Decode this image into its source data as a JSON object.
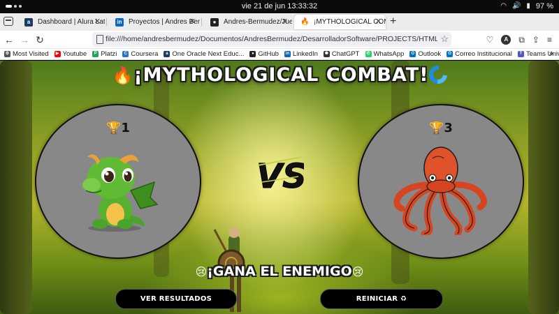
{
  "os": {
    "clock": "vie 21 de jun  13:33:32",
    "battery": "97 %"
  },
  "tabs": [
    {
      "label": "Dashboard | Alura Latam",
      "favicon": "alura-icon",
      "color": "#1a3c5e",
      "glyph": "a"
    },
    {
      "label": "Proyectos | Andres Bermu",
      "favicon": "linkedin-icon",
      "color": "#0a66c2",
      "glyph": "in"
    },
    {
      "label": "Andres-Bermudez/Juego",
      "favicon": "github-icon",
      "color": "#222222",
      "glyph": "●"
    },
    {
      "label": "¡MYTHOLOGICAL COMBA",
      "favicon": "fire-icon",
      "color": "#ff7a00",
      "glyph": "🔥"
    }
  ],
  "nav": {
    "url": "file:///home/andresbermudez/Documentos/AndresBermudez/DesarrolladorSoftware/PROJECTS/HTML - CSS - JAVASCRIPT/",
    "account_initial": "A"
  },
  "bookmarks": [
    {
      "label": "Most Visited",
      "icon": "gear-icon",
      "color": "#555555",
      "glyph": "⚙"
    },
    {
      "label": "Youtube",
      "icon": "youtube-icon",
      "color": "#ff0000",
      "glyph": "▶"
    },
    {
      "label": "Platzi",
      "icon": "platzi-icon",
      "color": "#22a35a",
      "glyph": "P"
    },
    {
      "label": "Coursera",
      "icon": "coursera-icon",
      "color": "#2a73cc",
      "glyph": "C"
    },
    {
      "label": "One Oracle Next Educ...",
      "icon": "alura-icon",
      "color": "#1a3c5e",
      "glyph": "a"
    },
    {
      "label": "GitHub",
      "icon": "github-icon",
      "color": "#222222",
      "glyph": "●"
    },
    {
      "label": "LinkedIn",
      "icon": "linkedin-icon",
      "color": "#0a66c2",
      "glyph": "in"
    },
    {
      "label": "ChatGPT",
      "icon": "chatgpt-icon",
      "color": "#333333",
      "glyph": "✺"
    },
    {
      "label": "WhatsApp",
      "icon": "whatsapp-icon",
      "color": "#25d366",
      "glyph": "✆"
    },
    {
      "label": "Outlook",
      "icon": "outlook-icon",
      "color": "#0072c6",
      "glyph": "O"
    },
    {
      "label": "Correo Institucional",
      "icon": "outlook-icon",
      "color": "#0072c6",
      "glyph": "O"
    },
    {
      "label": "Teams Universidad",
      "icon": "teams-icon",
      "color": "#5059c9",
      "glyph": "T"
    }
  ],
  "game": {
    "title": "¡MYTHOLOGICAL COMBAT!",
    "title_emoji": "🔥",
    "player": {
      "trophy": "🏆",
      "score": "1",
      "creature": "dragon-icon"
    },
    "enemy": {
      "trophy": "🏆",
      "score": "3",
      "creature": "octopus-icon"
    },
    "vs_label": "VS",
    "result_text": "¡GANA EL ENEMIGO",
    "result_emoji": "😢",
    "results_button": "VER RESULTADOS",
    "reset_button": "REINICIAR ♻"
  }
}
